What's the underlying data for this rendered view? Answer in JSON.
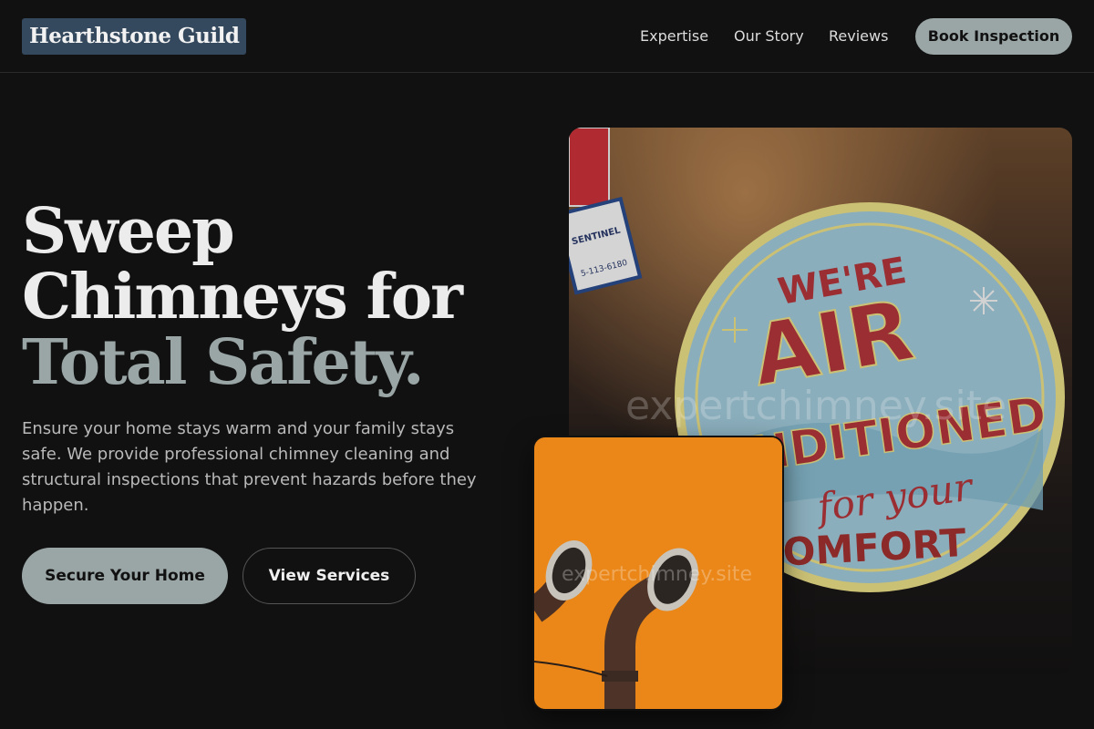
{
  "header": {
    "logo": "Hearthstone Guild",
    "nav": [
      "Expertise",
      "Our Story",
      "Reviews"
    ],
    "cta": "Book Inspection"
  },
  "hero": {
    "title_line1": "Sweep",
    "title_line2": "Chimneys for",
    "title_accent": "Total Safety.",
    "lead": "Ensure your home stays warm and your family stays safe. We provide professional chimney cleaning and structural inspections that prevent hazards before they happen.",
    "primary_button": "Secure Your Home",
    "secondary_button": "View Services"
  },
  "main_image": {
    "sign_line1": "WE'RE",
    "sign_line2": "AIR",
    "sign_line3": "CONDITIONED",
    "sign_line4": "for your",
    "sign_line5": "COMFORT",
    "sticker_label": "SENTINEL",
    "sticker_number": "5-113-6180",
    "watermark": "expertchimney.site"
  },
  "small_image": {
    "watermark": "expertchimney.site"
  },
  "colors": {
    "background": "#111111",
    "accent": "#9aa5a5",
    "logo_bg": "#34495e"
  }
}
